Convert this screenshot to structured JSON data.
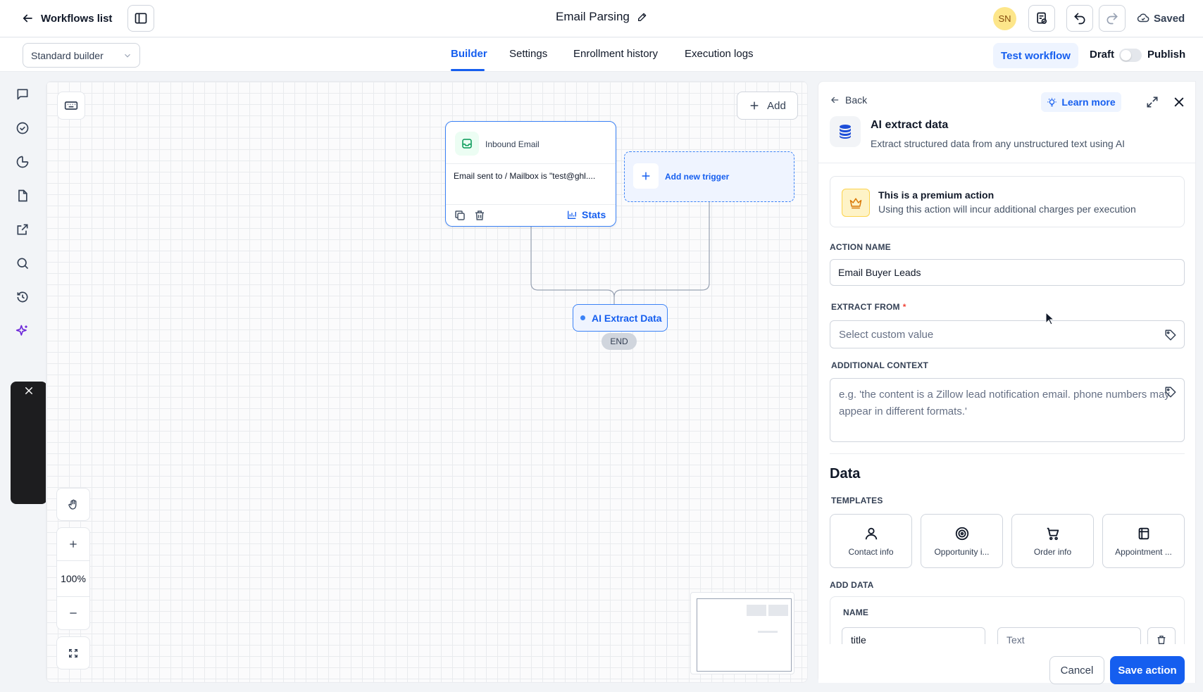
{
  "topbar": {
    "back_label": "Workflows list",
    "workflow_title": "Email Parsing",
    "avatar_initials": "SN",
    "saved_label": "Saved"
  },
  "subbar": {
    "builder_select": "Standard builder",
    "tabs": [
      {
        "label": "Builder",
        "active": true
      },
      {
        "label": "Settings",
        "active": false
      },
      {
        "label": "Enrollment history",
        "active": false
      },
      {
        "label": "Execution logs",
        "active": false
      }
    ],
    "test_label": "Test workflow",
    "draft_label": "Draft",
    "publish_label": "Publish",
    "published": false
  },
  "sidebar": {
    "icons": [
      "chat-icon",
      "check-circle-icon",
      "pie-chart-icon",
      "document-icon",
      "external-link-icon",
      "search-icon",
      "history-icon",
      "sparkle-icon"
    ]
  },
  "canvas": {
    "add_label": "Add",
    "trigger": {
      "name": "Inbound Email",
      "description": "Email sent to / Mailbox is \"test@ghl....",
      "stats_label": "Stats"
    },
    "add_trigger_label": "Add new trigger",
    "action_node_label": "AI Extract Data",
    "end_label": "END",
    "zoom_level": "100%"
  },
  "panel": {
    "back_label": "Back",
    "learn_more_label": "Learn more",
    "title": "AI extract data",
    "subtitle": "Extract structured data from any unstructured text using AI",
    "premium_title": "This is a premium action",
    "premium_sub": "Using this action will incur additional charges per execution",
    "action_name_label": "ACTION NAME",
    "action_name_value": "Email Buyer Leads",
    "extract_from_label": "EXTRACT FROM",
    "extract_from_required": "*",
    "extract_from_placeholder": "Select custom value",
    "context_label": "ADDITIONAL CONTEXT",
    "context_placeholder": "e.g. 'the content is a Zillow lead notification email. phone numbers may appear in different formats.'",
    "data_heading": "Data",
    "templates_label": "TEMPLATES",
    "templates": [
      {
        "label": "Contact info",
        "icon": "user-icon"
      },
      {
        "label": "Opportunity i...",
        "icon": "target-icon"
      },
      {
        "label": "Order info",
        "icon": "cart-icon"
      },
      {
        "label": "Appointment ...",
        "icon": "calendar-icon"
      }
    ],
    "add_data_label": "ADD DATA",
    "name_label": "NAME",
    "row_name_value": "title",
    "row_type_value": "Text",
    "cancel_label": "Cancel",
    "save_label": "Save action"
  },
  "colors": {
    "accent": "#155eef",
    "node_border": "#3b82f6",
    "premium_bg": "#fef3c7"
  }
}
